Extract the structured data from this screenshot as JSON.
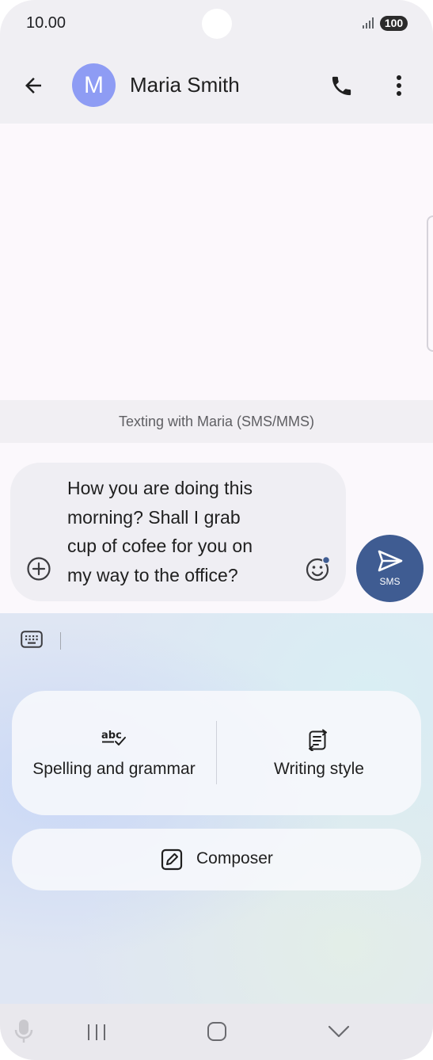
{
  "status": {
    "time": "10.00",
    "battery": "100"
  },
  "header": {
    "avatar_initial": "M",
    "contact_name": "Maria Smith"
  },
  "chat": {
    "texting_info": "Texting with Maria (SMS/MMS)"
  },
  "composer": {
    "message_lines": [
      "How you are doing this",
      "morning? Shall I grab",
      "cup of cofee for you on",
      "my way to the office?"
    ],
    "send_label": "SMS"
  },
  "writing_assist": {
    "spelling_label": "Spelling and grammar",
    "writing_style_label": "Writing style",
    "composer_label": "Composer"
  },
  "colors": {
    "accent": "#3f5c92",
    "avatar": "#8e9cf4"
  }
}
